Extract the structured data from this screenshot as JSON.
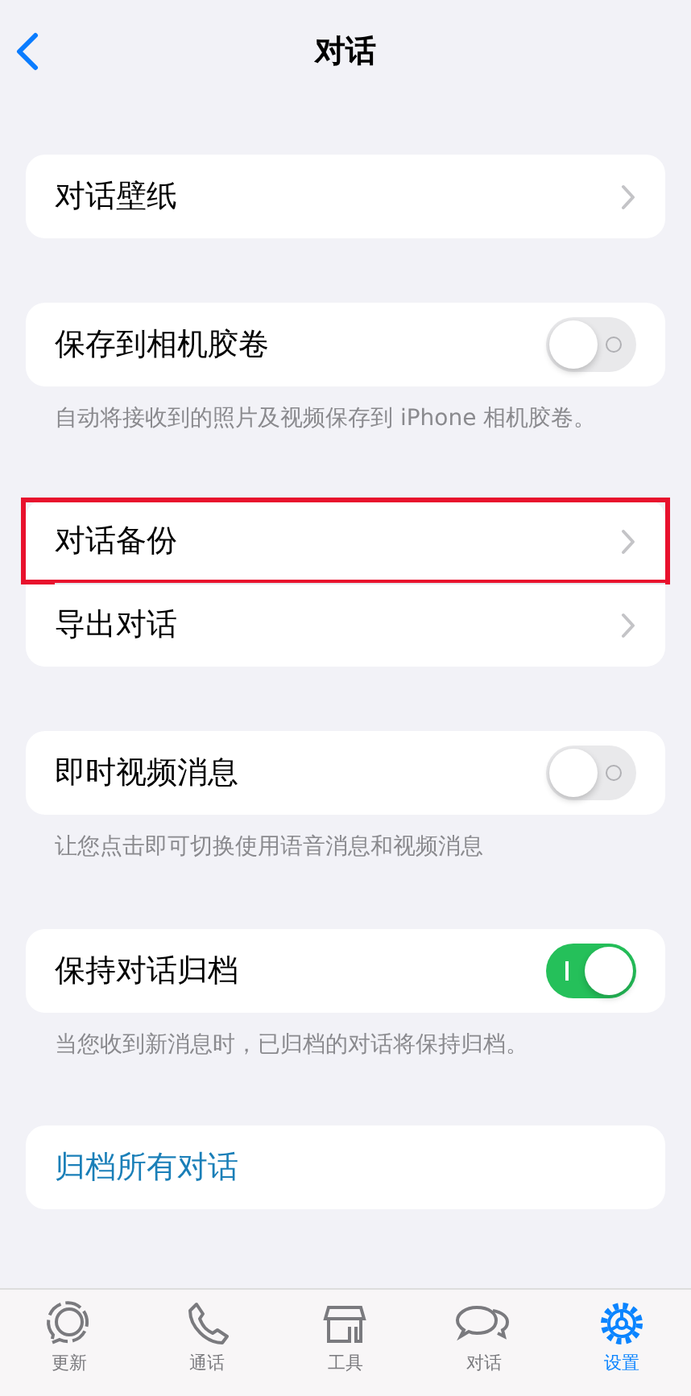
{
  "nav": {
    "title": "对话"
  },
  "sections": [
    {
      "rows": [
        {
          "kind": "link",
          "label": "对话壁纸",
          "highlighted": false
        }
      ]
    },
    {
      "rows": [
        {
          "kind": "toggle",
          "label": "保存到相机胶卷",
          "on": false,
          "highlighted": false
        }
      ],
      "footer": "自动将接收到的照片及视频保存到 iPhone 相机胶卷。"
    },
    {
      "rows": [
        {
          "kind": "link",
          "label": "对话备份",
          "highlighted": true
        },
        {
          "kind": "link",
          "label": "导出对话",
          "highlighted": false
        }
      ]
    },
    {
      "rows": [
        {
          "kind": "toggle",
          "label": "即时视频消息",
          "on": false,
          "highlighted": false
        }
      ],
      "footer": "让您点击即可切换使用语音消息和视频消息"
    },
    {
      "rows": [
        {
          "kind": "toggle",
          "label": "保持对话归档",
          "on": true,
          "highlighted": false
        }
      ],
      "footer": "当您收到新消息时，已归档的对话将保持归档。"
    },
    {
      "rows": [
        {
          "kind": "action",
          "label": "归档所有对话",
          "highlighted": false
        }
      ]
    }
  ],
  "tab_bar": [
    {
      "kind": "updates",
      "label": "更新",
      "selected": false
    },
    {
      "kind": "calls",
      "label": "通话",
      "selected": false
    },
    {
      "kind": "tools",
      "label": "工具",
      "selected": false
    },
    {
      "kind": "chats",
      "label": "对话",
      "selected": false
    },
    {
      "kind": "settings",
      "label": "设置",
      "selected": true
    }
  ]
}
